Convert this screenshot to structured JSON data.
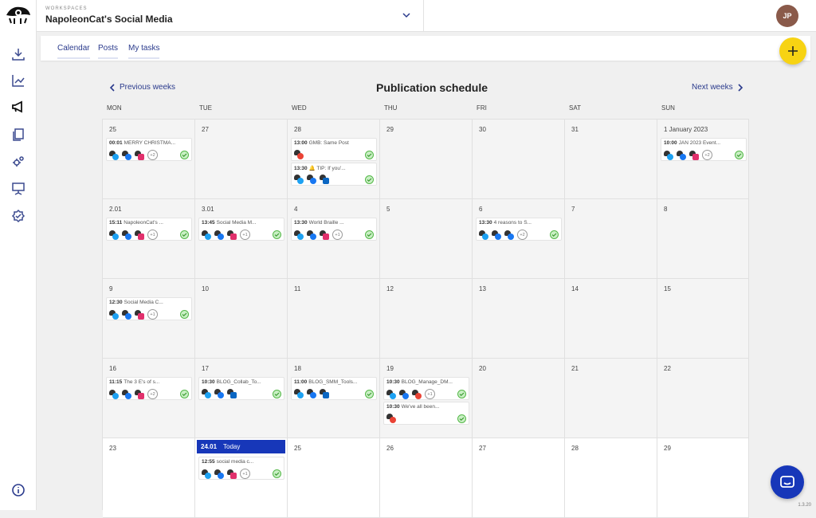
{
  "workspace": {
    "label": "WORKSPACES",
    "name": "NapoleonCat's Social Media"
  },
  "user": {
    "initials": "JP"
  },
  "tabs": [
    {
      "label": "Calendar"
    },
    {
      "label": "Posts"
    },
    {
      "label": "My tasks"
    }
  ],
  "schedule": {
    "title": "Publication schedule",
    "prev": "Previous weeks",
    "next": "Next weeks"
  },
  "weekdays": [
    "MON",
    "TUE",
    "WED",
    "THU",
    "FRI",
    "SAT",
    "SUN"
  ],
  "today": {
    "date": "24.01",
    "label": "Today"
  },
  "weeks": [
    {
      "days": [
        {
          "day": "25",
          "posts": [
            {
              "time": "00:01",
              "title": "MERRY CHRISTMA...",
              "icons": [
                "twitter-icon",
                "facebook-icon",
                "instagram-icon"
              ],
              "more": "+2"
            }
          ]
        },
        {
          "day": "27",
          "posts": []
        },
        {
          "day": "28",
          "posts": [
            {
              "time": "13:00",
              "title": "GMB: Same Post",
              "icons": [
                "google-icon"
              ],
              "more": ""
            },
            {
              "time": "13:30",
              "title": "🔔 TIP: If you'...",
              "icons": [
                "twitter-icon",
                "facebook-icon",
                "linkedin-icon"
              ],
              "more": ""
            }
          ]
        },
        {
          "day": "29",
          "posts": []
        },
        {
          "day": "30",
          "posts": []
        },
        {
          "day": "31",
          "posts": []
        },
        {
          "day": "1 January 2023",
          "posts": [
            {
              "time": "10:00",
              "title": "JAN 2023 Event...",
              "icons": [
                "twitter-icon",
                "facebook-icon",
                "instagram-icon"
              ],
              "more": "+2"
            }
          ]
        }
      ]
    },
    {
      "days": [
        {
          "day": "2.01",
          "posts": [
            {
              "time": "15:11",
              "title": "NapoleonCat's ...",
              "icons": [
                "twitter-icon",
                "facebook-icon",
                "instagram-icon"
              ],
              "more": "+1"
            }
          ]
        },
        {
          "day": "3.01",
          "posts": [
            {
              "time": "13:45",
              "title": "Social Media M...",
              "icons": [
                "twitter-icon",
                "facebook-icon",
                "instagram-icon"
              ],
              "more": "+1"
            }
          ]
        },
        {
          "day": "4",
          "posts": [
            {
              "time": "13:30",
              "title": "World Braille ...",
              "icons": [
                "twitter-icon",
                "facebook-icon",
                "instagram-icon"
              ],
              "more": "+1"
            }
          ]
        },
        {
          "day": "5",
          "posts": []
        },
        {
          "day": "6",
          "posts": [
            {
              "time": "13:30",
              "title": "4 reasons to S...",
              "icons": [
                "twitter-icon",
                "facebook-icon",
                "facebook-icon"
              ],
              "more": "+2"
            }
          ]
        },
        {
          "day": "7",
          "posts": []
        },
        {
          "day": "8",
          "posts": []
        }
      ]
    },
    {
      "days": [
        {
          "day": "9",
          "posts": [
            {
              "time": "12:30",
              "title": "Social Media C...",
              "icons": [
                "twitter-icon",
                "facebook-icon",
                "instagram-icon"
              ],
              "more": "+1"
            }
          ]
        },
        {
          "day": "10",
          "posts": []
        },
        {
          "day": "11",
          "posts": []
        },
        {
          "day": "12",
          "posts": []
        },
        {
          "day": "13",
          "posts": []
        },
        {
          "day": "14",
          "posts": []
        },
        {
          "day": "15",
          "posts": []
        }
      ]
    },
    {
      "days": [
        {
          "day": "16",
          "posts": [
            {
              "time": "11:15",
              "title": "The 3 E's of s...",
              "icons": [
                "twitter-icon",
                "facebook-icon",
                "instagram-icon"
              ],
              "more": "+2"
            }
          ]
        },
        {
          "day": "17",
          "posts": [
            {
              "time": "10:30",
              "title": "BLOG_Collab_To...",
              "icons": [
                "twitter-icon",
                "facebook-icon",
                "linkedin-icon"
              ],
              "more": ""
            }
          ]
        },
        {
          "day": "18",
          "posts": [
            {
              "time": "11:00",
              "title": "BLOG_SMM_Tools...",
              "icons": [
                "twitter-icon",
                "facebook-icon",
                "linkedin-icon"
              ],
              "more": ""
            }
          ]
        },
        {
          "day": "19",
          "posts": [
            {
              "time": "10:30",
              "title": "BLOG_Manage_DM...",
              "icons": [
                "twitter-icon",
                "facebook-icon",
                "google-icon"
              ],
              "more": "+1"
            },
            {
              "time": "10:30",
              "title": "We've all been...",
              "icons": [
                "google-icon"
              ],
              "more": ""
            }
          ]
        },
        {
          "day": "20",
          "posts": []
        },
        {
          "day": "21",
          "posts": []
        },
        {
          "day": "22",
          "posts": []
        }
      ]
    },
    {
      "days": [
        {
          "day": "23",
          "posts": []
        },
        {
          "day": "",
          "today": true,
          "posts": [
            {
              "time": "12:55",
              "title": "social media c...",
              "icons": [
                "twitter-icon",
                "facebook-icon",
                "instagram-icon"
              ],
              "more": "+1"
            }
          ]
        },
        {
          "day": "25",
          "posts": []
        },
        {
          "day": "26",
          "posts": []
        },
        {
          "day": "27",
          "posts": []
        },
        {
          "day": "28",
          "posts": []
        },
        {
          "day": "29",
          "posts": []
        }
      ]
    }
  ],
  "version": "1.3.20",
  "colors": {
    "accent": "#1737b9",
    "fab": "#f7d313",
    "published": "#54b848"
  }
}
